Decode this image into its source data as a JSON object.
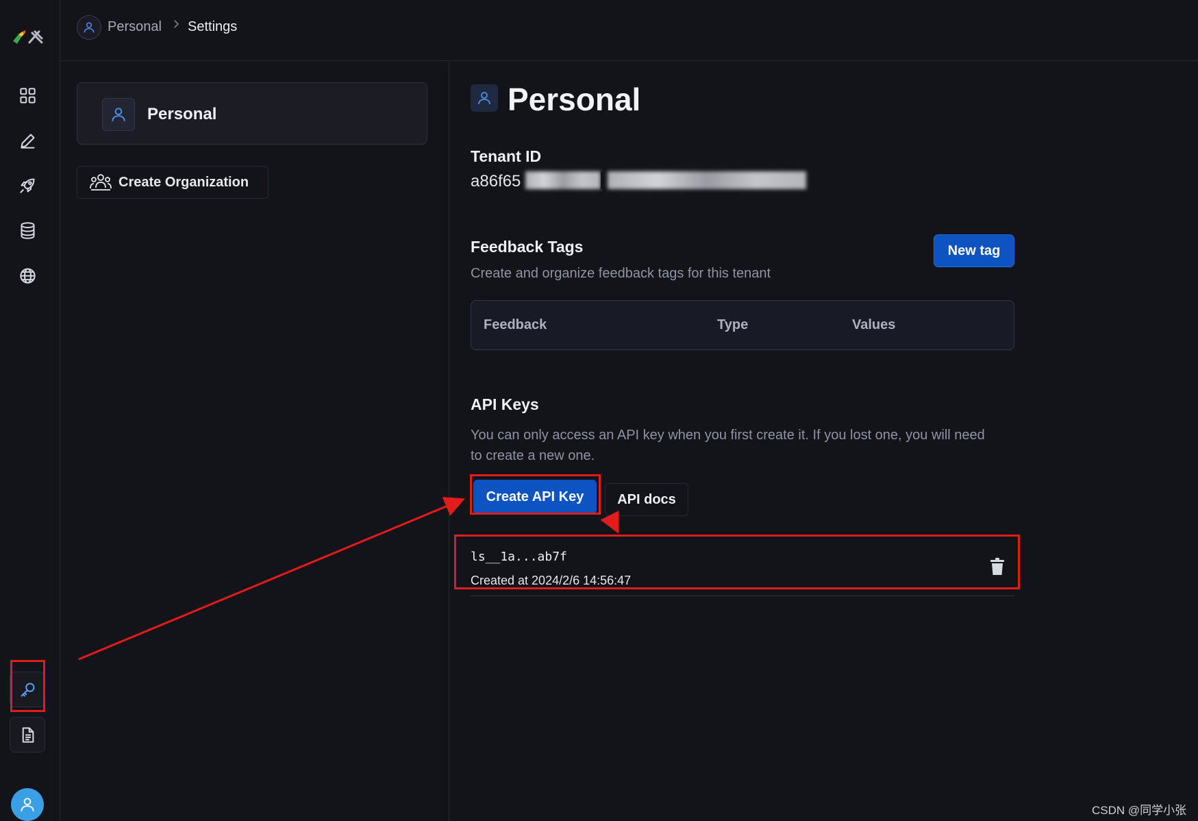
{
  "breadcrumb": {
    "items": [
      "Personal",
      "Settings"
    ]
  },
  "tenant_card": {
    "label": "Personal"
  },
  "create_org": {
    "label": "Create Organization"
  },
  "page": {
    "title": "Personal"
  },
  "tenant_id": {
    "label": "Tenant ID",
    "value_visible": "a86f65"
  },
  "feedback_tags": {
    "title": "Feedback Tags",
    "description": "Create and organize feedback tags for this tenant",
    "new_tag_label": "New tag",
    "columns": [
      "Feedback",
      "Type",
      "Values"
    ]
  },
  "api_keys": {
    "title": "API Keys",
    "description": "You can only access an API key when you first create it. If you lost one, you will need to create a new one.",
    "create_label": "Create API Key",
    "docs_label": "API docs",
    "keys": [
      {
        "name": "ls__1a...ab7f",
        "created": "Created at 2024/2/6 14:56:47"
      }
    ]
  },
  "watermark": "CSDN @同学小张",
  "colors": {
    "accent": "#0d53c2",
    "annotation": "#e21b1b",
    "background": "#13131a"
  },
  "icons": [
    "grid-icon",
    "pencil-icon",
    "rocket-icon",
    "database-icon",
    "globe-icon",
    "key-icon",
    "document-icon",
    "user-icon",
    "users-icon",
    "trash-icon",
    "chevron-right-icon"
  ]
}
